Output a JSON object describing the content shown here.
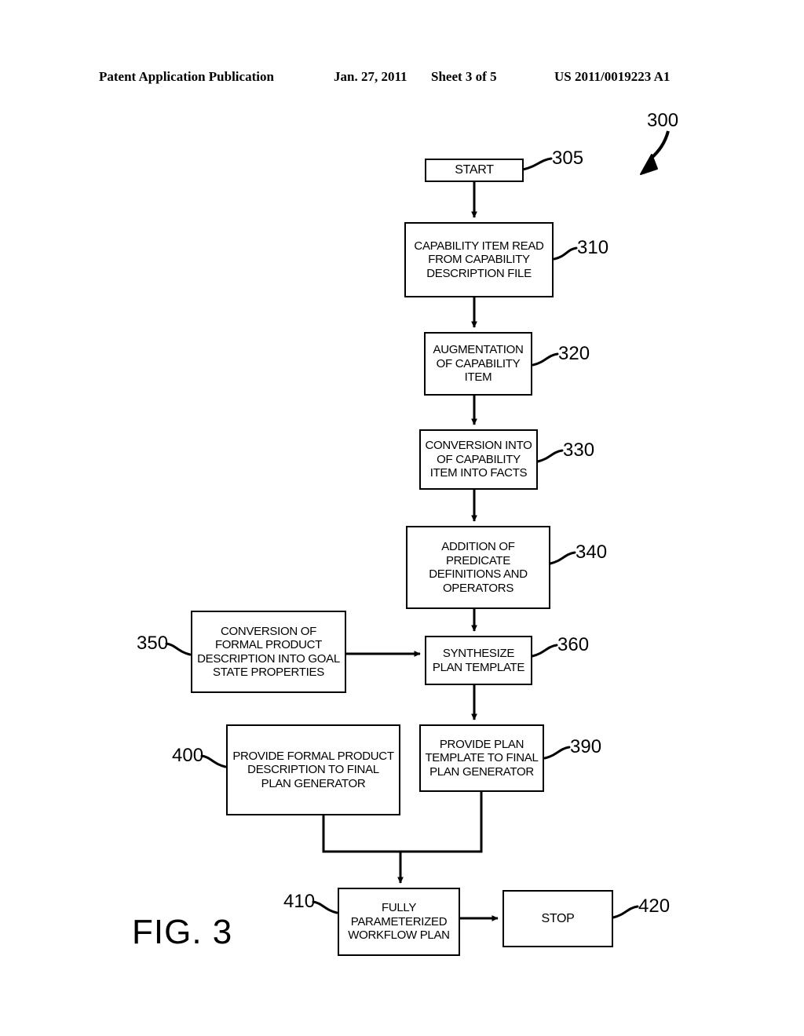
{
  "header": {
    "publication": "Patent Application Publication",
    "date": "Jan. 27, 2011",
    "sheet": "Sheet 3 of 5",
    "patent_number": "US 2011/0019223 A1"
  },
  "figure": {
    "caption": "FIG. 3",
    "diagram_number": "300"
  },
  "nodes": [
    {
      "id": "305",
      "label": "START"
    },
    {
      "id": "310",
      "label": "CAPABILITY ITEM READ\nFROM CAPABILITY\nDESCRIPTION FILE"
    },
    {
      "id": "320",
      "label": "AUGMENTATION\nOF CAPABILITY\nITEM"
    },
    {
      "id": "330",
      "label": "CONVERSION INTO\nOF CAPABILITY\nITEM INTO FACTS"
    },
    {
      "id": "340",
      "label": "ADDITION OF\nPREDICATE\nDEFINITIONS AND\nOPERATORS"
    },
    {
      "id": "350",
      "label": "CONVERSION OF\nFORMAL PRODUCT\nDESCRIPTION INTO GOAL\nSTATE PROPERTIES"
    },
    {
      "id": "360",
      "label": "SYNTHESIZE\nPLAN TEMPLATE"
    },
    {
      "id": "390",
      "label": "PROVIDE PLAN\nTEMPLATE TO FINAL\nPLAN GENERATOR"
    },
    {
      "id": "400",
      "label": "PROVIDE FORMAL PRODUCT\nDESCRIPTION TO FINAL\nPLAN GENERATOR"
    },
    {
      "id": "410",
      "label": "FULLY\nPARAMETERIZED\nWORKFLOW PLAN"
    },
    {
      "id": "420",
      "label": "STOP"
    }
  ],
  "reference_numerals": {
    "n300": "300",
    "n305": "305",
    "n310": "310",
    "n320": "320",
    "n330": "330",
    "n340": "340",
    "n350": "350",
    "n360": "360",
    "n390": "390",
    "n400": "400",
    "n410": "410",
    "n420": "420"
  },
  "colors": {
    "ink": "#000000",
    "paper": "#ffffff"
  }
}
